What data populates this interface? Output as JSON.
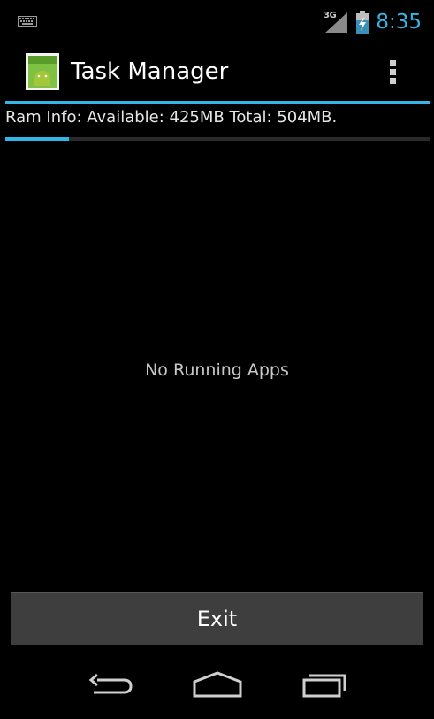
{
  "status_bar": {
    "network_type": "3G",
    "time": "8:35",
    "icons": [
      "keyboard-icon",
      "signal-icon",
      "battery-charging-icon"
    ]
  },
  "action_bar": {
    "title": "Task Manager",
    "app_icon": "android-app-icon",
    "overflow_icon": "overflow-menu-icon"
  },
  "ram": {
    "info_text": "Ram Info: Available: 425MB Total: 504MB.",
    "used_fraction": 0.15
  },
  "main": {
    "empty_message": "No Running Apps"
  },
  "buttons": {
    "exit_label": "Exit"
  },
  "nav_bar": {
    "icons": [
      "back-icon",
      "home-icon",
      "recent-apps-icon"
    ]
  },
  "colors": {
    "accent": "#33b5e5",
    "background": "#000000",
    "button": "#3e3e3e"
  }
}
